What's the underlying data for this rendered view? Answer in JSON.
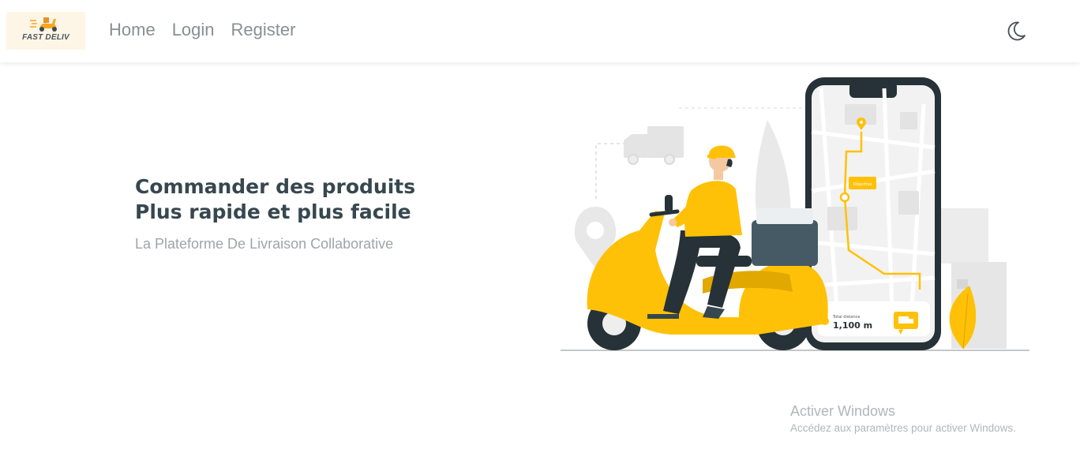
{
  "navbar": {
    "logo_text": "FAST DELIV",
    "links": [
      "Home",
      "Login",
      "Register"
    ],
    "theme_icon": "moon-icon"
  },
  "hero": {
    "title_line1": "Commander des produits",
    "title_line2": "Plus rapide et plus facile",
    "subtitle": "La Plateforme De Livraison Collaborative"
  },
  "illustration": {
    "map_label": "Objective",
    "distance_label": "Total distance",
    "distance_value": "1,100 m"
  },
  "watermark": {
    "title": "Activer Windows",
    "subtitle": "Accédez aux paramètres pour activer Windows."
  },
  "colors": {
    "accent": "#ffc107",
    "dark": "#37474f",
    "nav_text": "#8a8f94"
  }
}
